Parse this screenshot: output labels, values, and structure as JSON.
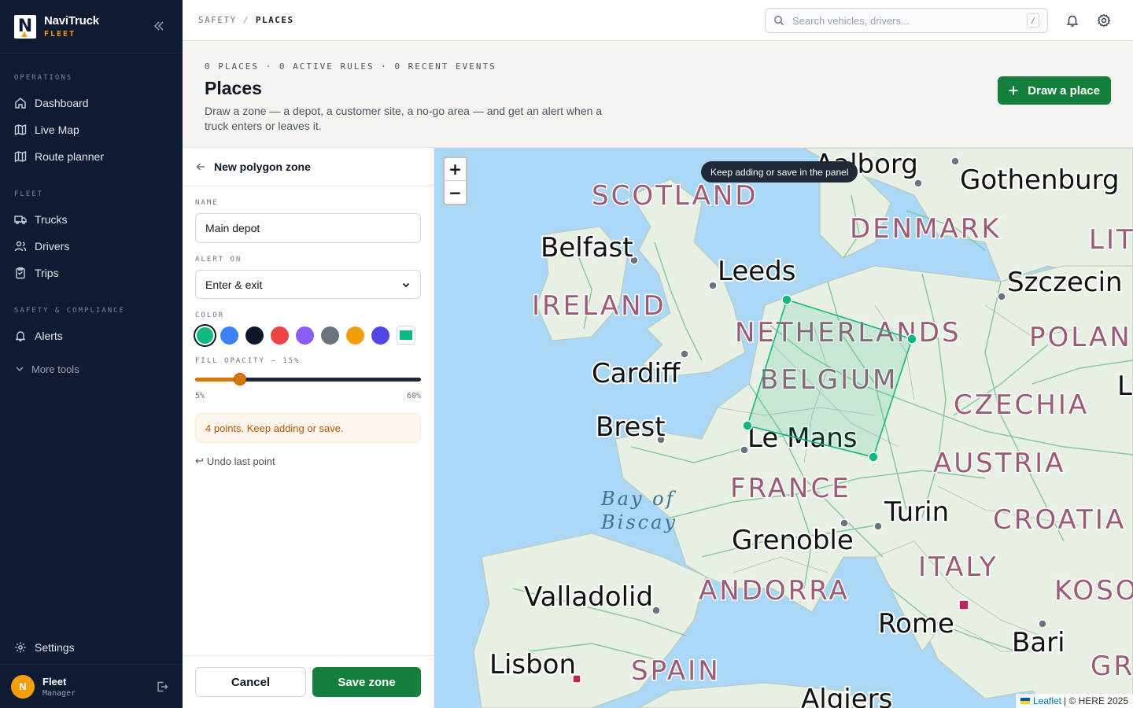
{
  "brand": {
    "name": "NaviTruck",
    "sub": "FLEET"
  },
  "nav": {
    "sections": {
      "operations": "OPERATIONS",
      "fleet": "FLEET",
      "safety": "SAFETY & COMPLIANCE"
    },
    "items": {
      "dashboard": "Dashboard",
      "live_map": "Live Map",
      "route_planner": "Route planner",
      "trucks": "Trucks",
      "drivers": "Drivers",
      "trips": "Trips",
      "alerts": "Alerts",
      "more_tools": "More tools",
      "settings": "Settings"
    }
  },
  "user": {
    "initial": "N",
    "name": "Fleet",
    "role": "Manager"
  },
  "breadcrumb": {
    "parent": "SAFETY",
    "sep": "/",
    "current": "PLACES"
  },
  "search": {
    "placeholder": "Search vehicles, drivers...",
    "shortcut": "/"
  },
  "header": {
    "stats": "0 PLACES · 0 ACTIVE RULES · 0 RECENT EVENTS",
    "title": "Places",
    "description": "Draw a zone — a depot, a customer site, a no-go area — and get an alert when a truck enters or leaves it.",
    "draw_button": "Draw a place"
  },
  "panel": {
    "title": "New polygon zone",
    "name_label": "NAME",
    "name_value": "Main depot",
    "alert_label": "ALERT ON",
    "alert_value": "Enter & exit",
    "color_label": "COLOR",
    "colors": [
      "#10b981",
      "#3b82f6",
      "#0f172a",
      "#ef4444",
      "#8b5cf6",
      "#6b7280",
      "#f59e0b",
      "#4f46e5"
    ],
    "selected_color": "#10b981",
    "opacity_label": "FILL OPACITY — 15%",
    "opacity_value": 15,
    "opacity_min": 5,
    "opacity_max": 60,
    "opacity_min_label": "5%",
    "opacity_max_label": "60%",
    "notice": "4 points. Keep adding or save.",
    "undo": "Undo last point",
    "undo_glyph": "↩",
    "cancel": "Cancel",
    "save": "Save zone"
  },
  "map": {
    "zoom_in": "+",
    "zoom_out": "−",
    "tooltip": "Keep adding or save in the panel",
    "attribution_leaflet": "Leaflet",
    "attribution_rest": "| © HERE 2025",
    "cities": {
      "aalborg": "Aalborg",
      "gothenburg": "Gothenburg",
      "belfast": "Belfast",
      "leeds": "Leeds",
      "szczecin": "Szczecin",
      "cardiff": "Cardiff",
      "brest": "Brest",
      "le_mans": "Le Mans",
      "turin": "Turin",
      "grenoble": "Grenoble",
      "valladolid": "Valladolid",
      "rome": "Rome",
      "bari": "Bari",
      "lisbon": "Lisbon",
      "algiers": "Algiers",
      "lv": "L’v"
    },
    "countries": {
      "scotland": "SCOTLAND",
      "denmark": "DENMARK",
      "lit": "LIT",
      "ireland": "IRELAND",
      "netherlands": "NETHERLANDS",
      "poland": "POLAN",
      "belgium": "BELGIUM",
      "czechia": "CZECHIA",
      "austria": "AUSTRIA",
      "france": "FRANCE",
      "croatia": "CROATIA",
      "italy": "ITALY",
      "andorra": "ANDORRA",
      "kosovo": "KOSO",
      "spain": "SPAIN",
      "greece": "GR"
    },
    "seas": {
      "biscay_1": "Bay of",
      "biscay_2": "Biscay"
    }
  }
}
